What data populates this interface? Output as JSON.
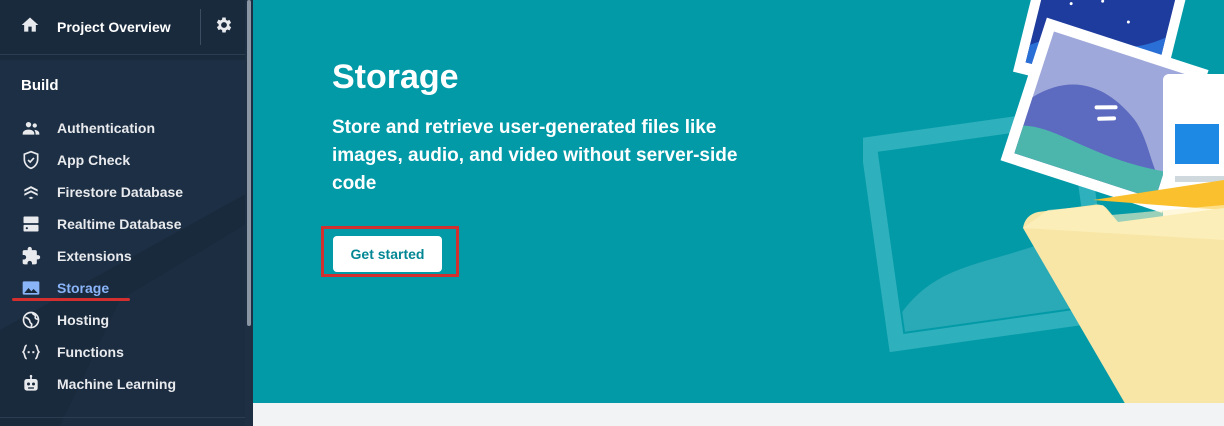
{
  "sidebar": {
    "project_overview": "Project Overview",
    "section_title": "Build",
    "items": [
      {
        "label": "Authentication",
        "icon": "people-icon"
      },
      {
        "label": "App Check",
        "icon": "shield-check-icon"
      },
      {
        "label": "Firestore Database",
        "icon": "firestore-icon"
      },
      {
        "label": "Realtime Database",
        "icon": "database-icon"
      },
      {
        "label": "Extensions",
        "icon": "puzzle-icon"
      },
      {
        "label": "Storage",
        "icon": "image-icon",
        "active": true
      },
      {
        "label": "Hosting",
        "icon": "globe-icon"
      },
      {
        "label": "Functions",
        "icon": "functions-icon"
      },
      {
        "label": "Machine Learning",
        "icon": "robot-icon"
      }
    ]
  },
  "hero": {
    "title": "Storage",
    "description": "Store and retrieve user-generated files like images, audio, and video without server-side code",
    "cta_label": "Get started"
  },
  "colors": {
    "sidebar_bg": "#1a2a3d",
    "hero_bg": "#039aa8",
    "active_text": "#8ab4f8",
    "highlight": "#d32f2f"
  }
}
